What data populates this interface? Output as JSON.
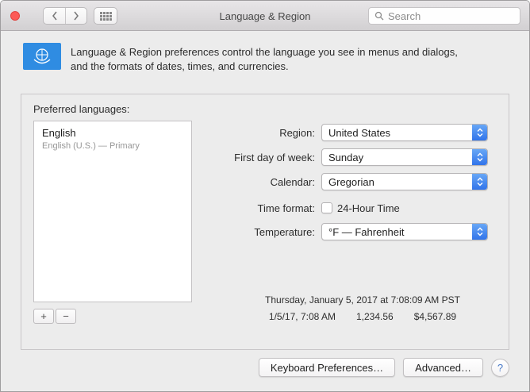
{
  "window": {
    "title": "Language & Region",
    "search_placeholder": "Search"
  },
  "intro": {
    "line1": "Language & Region preferences control the language you see in menus and dialogs,",
    "line2": "and the formats of dates, times, and currencies."
  },
  "languages": {
    "label": "Preferred languages:",
    "items": [
      {
        "name": "English",
        "detail": "English (U.S.) — Primary"
      }
    ],
    "add": "+",
    "remove": "−"
  },
  "form": {
    "region_label": "Region:",
    "region_value": "United States",
    "first_day_label": "First day of week:",
    "first_day_value": "Sunday",
    "calendar_label": "Calendar:",
    "calendar_value": "Gregorian",
    "time_format_label": "Time format:",
    "time_format_option": "24-Hour Time",
    "temperature_label": "Temperature:",
    "temperature_value": "°F — Fahrenheit"
  },
  "preview": {
    "full_date": "Thursday, January 5, 2017 at 7:08:09 AM PST",
    "short_date": "1/5/17, 7:08 AM",
    "number": "1,234.56",
    "currency": "$4,567.89"
  },
  "footer": {
    "keyboard": "Keyboard Preferences…",
    "advanced": "Advanced…",
    "help": "?"
  }
}
